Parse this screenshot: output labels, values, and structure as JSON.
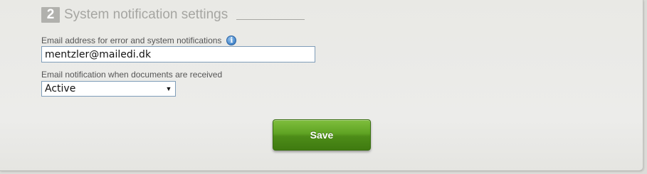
{
  "section": {
    "step_number": "2",
    "title": "System notification settings"
  },
  "email_field": {
    "label": "Email address for error and system notifications",
    "value": "mentzler@mailedi.dk",
    "info_icon": "info-icon"
  },
  "notification_field": {
    "label": "Email notification when documents are received",
    "selected": "Active"
  },
  "actions": {
    "save_label": "Save"
  },
  "colors": {
    "save_button": "#5fa323",
    "input_border": "#7f9db9",
    "info_icon": "#4f8fd0"
  }
}
